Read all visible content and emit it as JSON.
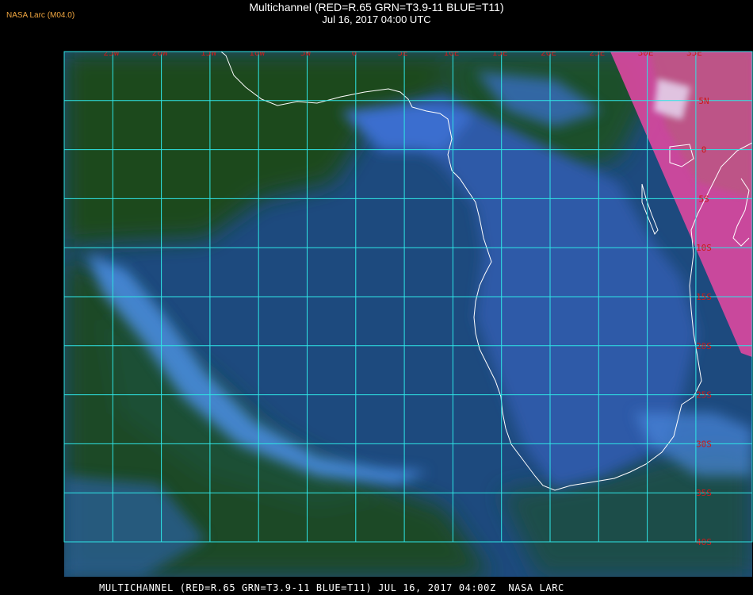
{
  "header": {
    "agency_label": "NASA Larc (M04.0)",
    "title": "Multichannel (RED=R.65 GRN=T3.9-11 BLUE=T11)",
    "subtitle": "Jul 16, 2017 04:00 UTC"
  },
  "map": {
    "longitude_labels": [
      "25W",
      "20W",
      "15W",
      "10W",
      "5W",
      "0",
      "5E",
      "10E",
      "15E",
      "20E",
      "25E",
      "30E",
      "35E"
    ],
    "latitude_labels": [
      "5N",
      "0",
      "5S",
      "10S",
      "15S",
      "20S",
      "25S",
      "30S",
      "35S",
      "40S"
    ],
    "colors": {
      "grid": "#2ee6e6",
      "coast": "#ffffff",
      "label": "#cc1a1a",
      "ocean": "#1d4a7e",
      "land": "#2d4d7d",
      "cloud_green": "#1c4a1c",
      "cloud_blue": "#3a7ad8",
      "cloud_magenta": "#e050a8"
    }
  },
  "footer": {
    "caption": "MULTICHANNEL (RED=R.65 GRN=T3.9-11 BLUE=T11) JUL 16, 2017 04:00Z  NASA LARC"
  }
}
